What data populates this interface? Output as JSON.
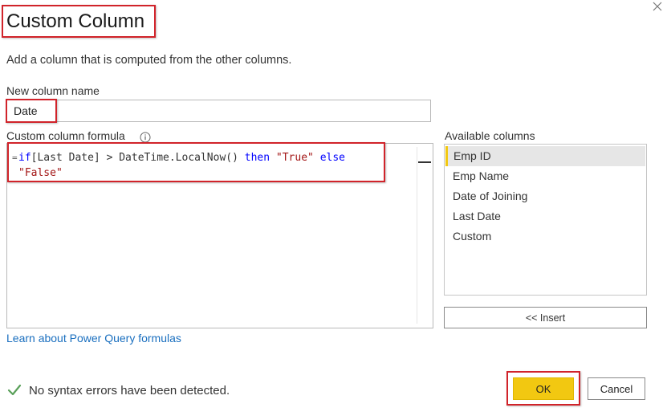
{
  "dialog": {
    "title": "Custom Column",
    "subtitle": "Add a column that is computed from the other columns.",
    "close_icon": "close-icon"
  },
  "new_column": {
    "label": "New column name",
    "value": "Date"
  },
  "formula": {
    "label": "Custom column formula",
    "info_icon": "info-icon",
    "prefix": "=",
    "tokens": {
      "kw_if": "if",
      "expr": "[Last Date] > DateTime.LocalNow() ",
      "kw_then": "then",
      "str_true": "\"True\"",
      "kw_else": "else",
      "str_false": "\"False\""
    }
  },
  "learn_link": "Learn about Power Query formulas",
  "available_columns": {
    "label": "Available columns",
    "items": [
      "Emp ID",
      "Emp Name",
      "Date of Joining",
      "Last Date",
      "Custom"
    ],
    "selected": "Emp ID",
    "insert_label": "<< Insert"
  },
  "status": {
    "icon": "checkmark-icon",
    "text": "No syntax errors have been detected.",
    "color": "#5aa05a"
  },
  "buttons": {
    "ok_label": "OK",
    "cancel_label": "Cancel"
  },
  "colors": {
    "accent": "#f2c811",
    "highlight_border": "#d1232a",
    "keyword": "#0000ff",
    "string": "#a31515",
    "link": "#1a6fbf"
  }
}
